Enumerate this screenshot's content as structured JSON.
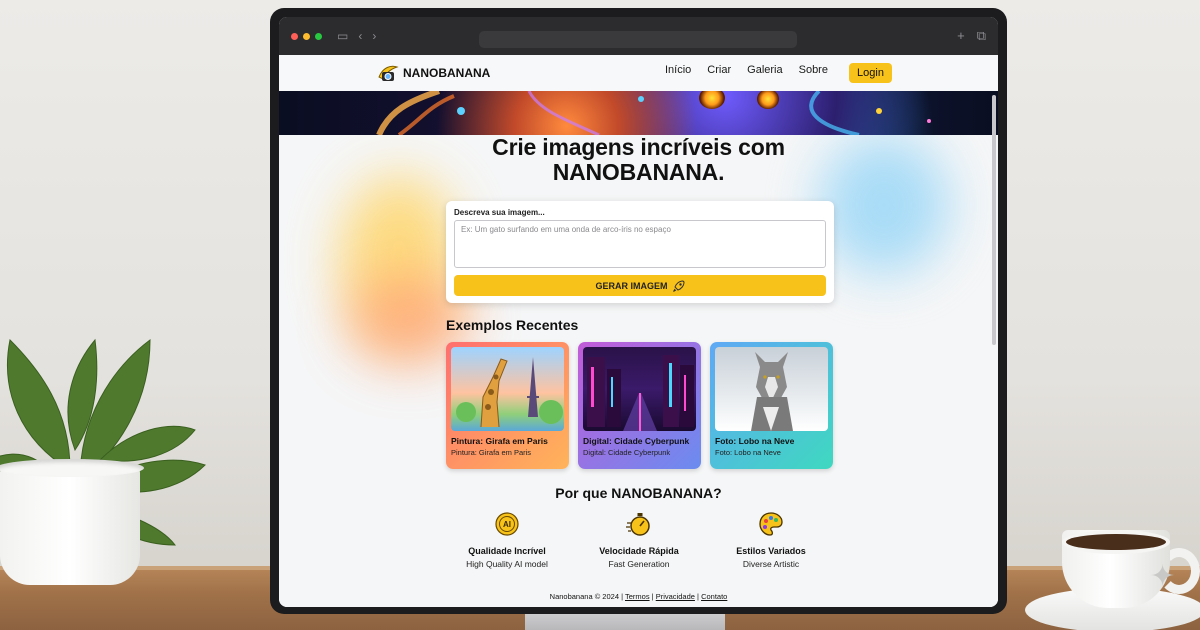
{
  "nav": {
    "brand": "NANOBANANA",
    "links": [
      "Início",
      "Criar",
      "Galeria",
      "Sobre"
    ],
    "login": "Login"
  },
  "hero": {
    "line1": "Crie imagens incríveis com",
    "line2": "NANOBANANA."
  },
  "prompt": {
    "label": "Descreva sua imagem...",
    "placeholder": "Ex: Um gato surfando em uma onda de arco-íris no espaço",
    "button": "GERAR IMAGEM"
  },
  "examples": {
    "title": "Exemplos Recentes",
    "items": [
      {
        "title": "Pintura: Girafa em Paris",
        "subtitle": "Pintura: Girafa em Paris"
      },
      {
        "title": "Digital: Cidade Cyberpunk",
        "subtitle": "Digital: Cidade Cyberpunk"
      },
      {
        "title": "Foto: Lobo na Neve",
        "subtitle": "Foto: Lobo na Neve"
      }
    ]
  },
  "why": {
    "title": "Por que NANOBANANA?",
    "features": [
      {
        "title": "Qualidade Incrível",
        "subtitle": "High Quality AI model",
        "icon": "ai-badge-icon"
      },
      {
        "title": "Velocidade Rápida",
        "subtitle": "Fast Generation",
        "icon": "stopwatch-icon"
      },
      {
        "title": "Estilos Variados",
        "subtitle": "Diverse Artistic",
        "icon": "palette-icon"
      }
    ]
  },
  "footer": {
    "copyright": "Nanobanana © 2024 |",
    "terms": "Termos",
    "sep1": "|",
    "privacy": "Privacidade",
    "sep2": "|",
    "contact": "Contato"
  },
  "colors": {
    "accent": "#f7c21a",
    "text": "#111111"
  }
}
